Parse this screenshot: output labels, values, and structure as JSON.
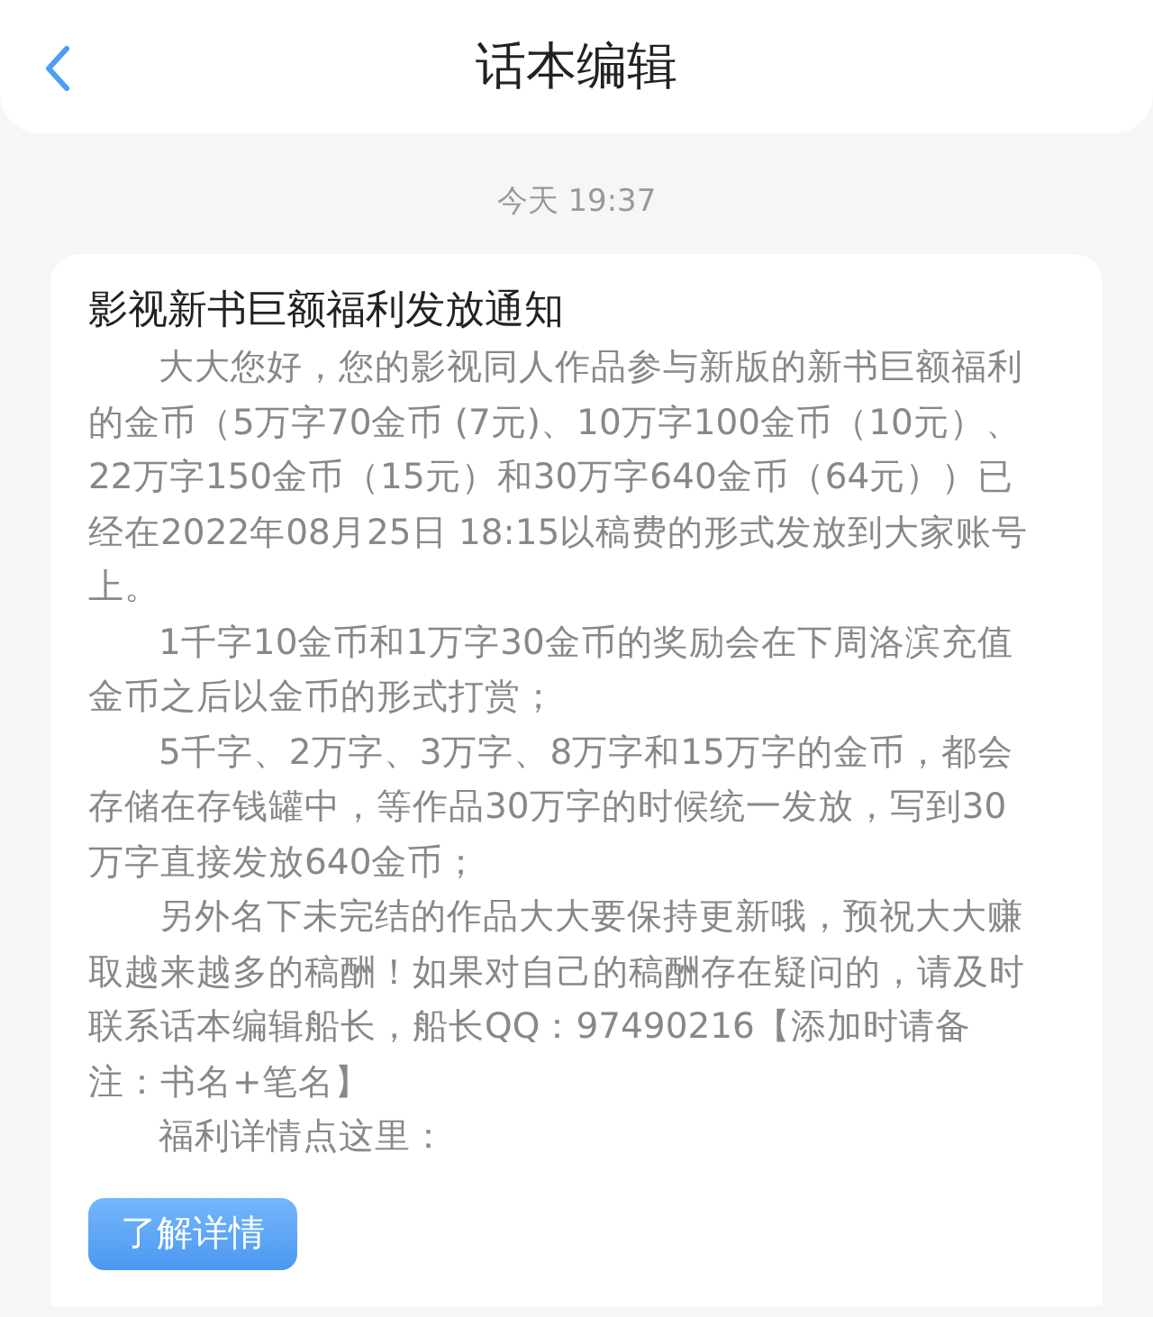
{
  "header": {
    "title": "话本编辑"
  },
  "timestamp": "今天 19:37",
  "message": {
    "title": "影视新书巨额福利发放通知",
    "paragraphs": [
      "大大您好，您的影视同人作品参与新版的新书巨额福利的金币（5万字70金币 (7元)、10万字100金币（10元）、22万字150金币（15元）和30万字640金币（64元））已经在2022年08月25日 18:15以稿费的形式发放到大家账号上。",
      "1千字10金币和1万字30金币的奖励会在下周洛滨充值金币之后以金币的形式打赏；",
      "5千字、2万字、3万字、8万字和15万字的金币，都会存储在存钱罐中，等作品30万字的时候统一发放，写到30万字直接发放640金币；",
      "另外名下未完结的作品大大要保持更新哦，预祝大大赚取越来越多的稿酬！如果对自己的稿酬存在疑问的，请及时联系话本编辑船长，船长QQ：97490216【添加时请备注：书名+笔名】",
      "福利详情点这里："
    ],
    "button": "了解详情"
  }
}
